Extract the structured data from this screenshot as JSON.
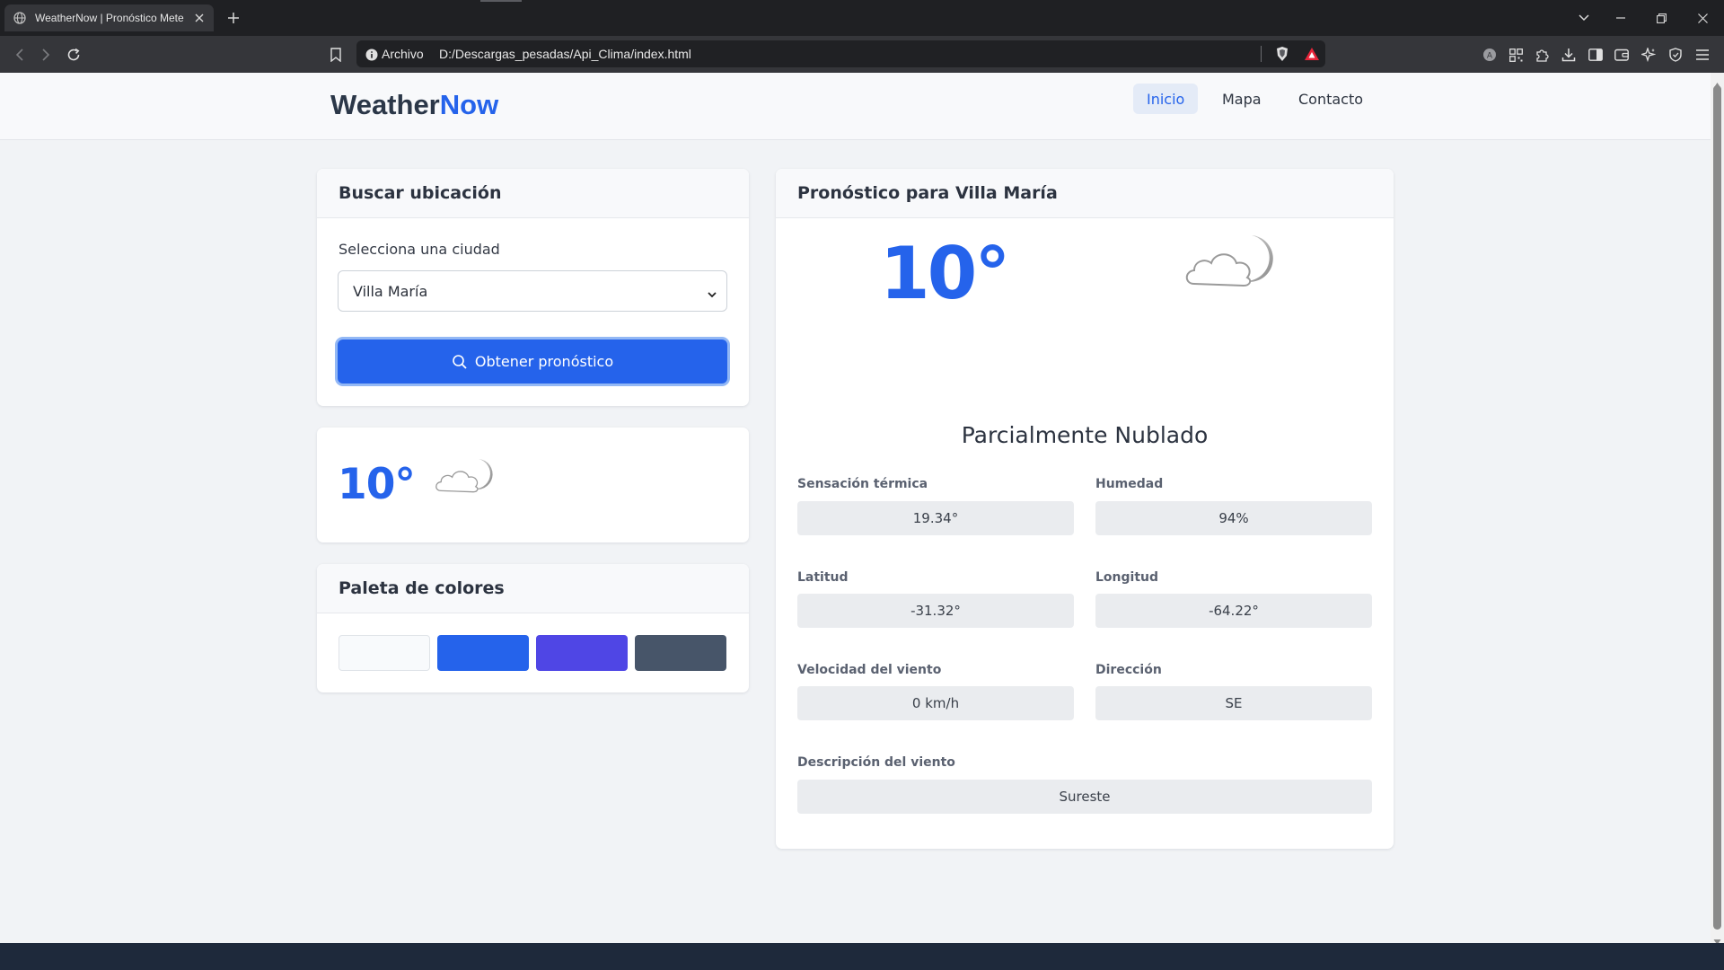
{
  "browser": {
    "tab_title": "WeatherNow | Pronóstico Mete",
    "address_label": "Archivo",
    "url": "D:/Descargas_pesadas/Api_Clima/index.html"
  },
  "navbar": {
    "brand_part1": "Weather",
    "brand_part2": "Now",
    "links": [
      {
        "label": "Inicio",
        "active": true
      },
      {
        "label": "Mapa",
        "active": false
      },
      {
        "label": "Contacto",
        "active": false
      }
    ]
  },
  "search": {
    "title": "Buscar ubicación",
    "select_label": "Selecciona una ciudad",
    "selected_city": "Villa María",
    "button_label": "Obtener pronóstico"
  },
  "mini_weather": {
    "temperature": "10°",
    "icon": "partly-cloudy-night-icon"
  },
  "palette": {
    "title": "Paleta de colores",
    "colors": [
      "#f8fafc",
      "#2563eb",
      "#4f46e5",
      "#475569"
    ]
  },
  "forecast": {
    "title": "Pronóstico para Villa María",
    "temperature": "10°",
    "icon": "partly-cloudy-night-icon",
    "condition": "Parcialmente Nublado",
    "details": [
      {
        "label": "Sensación térmica",
        "value": "19.34°"
      },
      {
        "label": "Humedad",
        "value": "94%"
      },
      {
        "label": "Latitud",
        "value": "-31.32°"
      },
      {
        "label": "Longitud",
        "value": "-64.22°"
      },
      {
        "label": "Velocidad del viento",
        "value": "0 km/h"
      },
      {
        "label": "Dirección",
        "value": "SE"
      }
    ],
    "wind_description_label": "Descripción del viento",
    "wind_description": "Sureste"
  },
  "colors": {
    "accent": "#2563eb",
    "text_dark": "#2c3340",
    "footer": "#1e293b"
  }
}
